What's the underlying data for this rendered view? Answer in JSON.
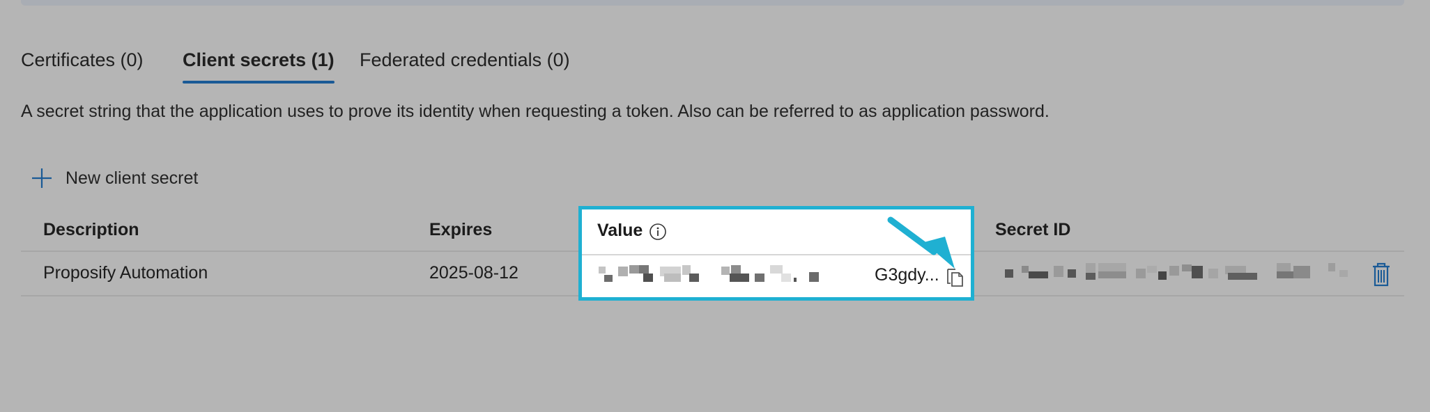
{
  "tabs": [
    {
      "label": "Certificates (0)",
      "active": false
    },
    {
      "label": "Client secrets (1)",
      "active": true
    },
    {
      "label": "Federated credentials (0)",
      "active": false
    }
  ],
  "description": "A secret string that the application uses to prove its identity when requesting a token. Also can be referred to as application password.",
  "new_secret_label": "New client secret",
  "table": {
    "headers": {
      "description": "Description",
      "expires": "Expires",
      "value": "Value",
      "secret_id": "Secret ID"
    },
    "rows": [
      {
        "description": "Proposify Automation",
        "expires": "2025-08-12",
        "value_visible": "G3gdy..."
      }
    ]
  },
  "icons": {
    "add": "plus-icon",
    "info": "info-icon",
    "copy": "copy-icon",
    "delete": "trash-icon",
    "annotation": "arrow-icon"
  },
  "colors": {
    "background": "#b5b5b5",
    "active_tab_underline": "#1a5a96",
    "highlight_border": "#1fb0d2",
    "arrow": "#1fb0d2",
    "delete_icon": "#1a5a96"
  }
}
